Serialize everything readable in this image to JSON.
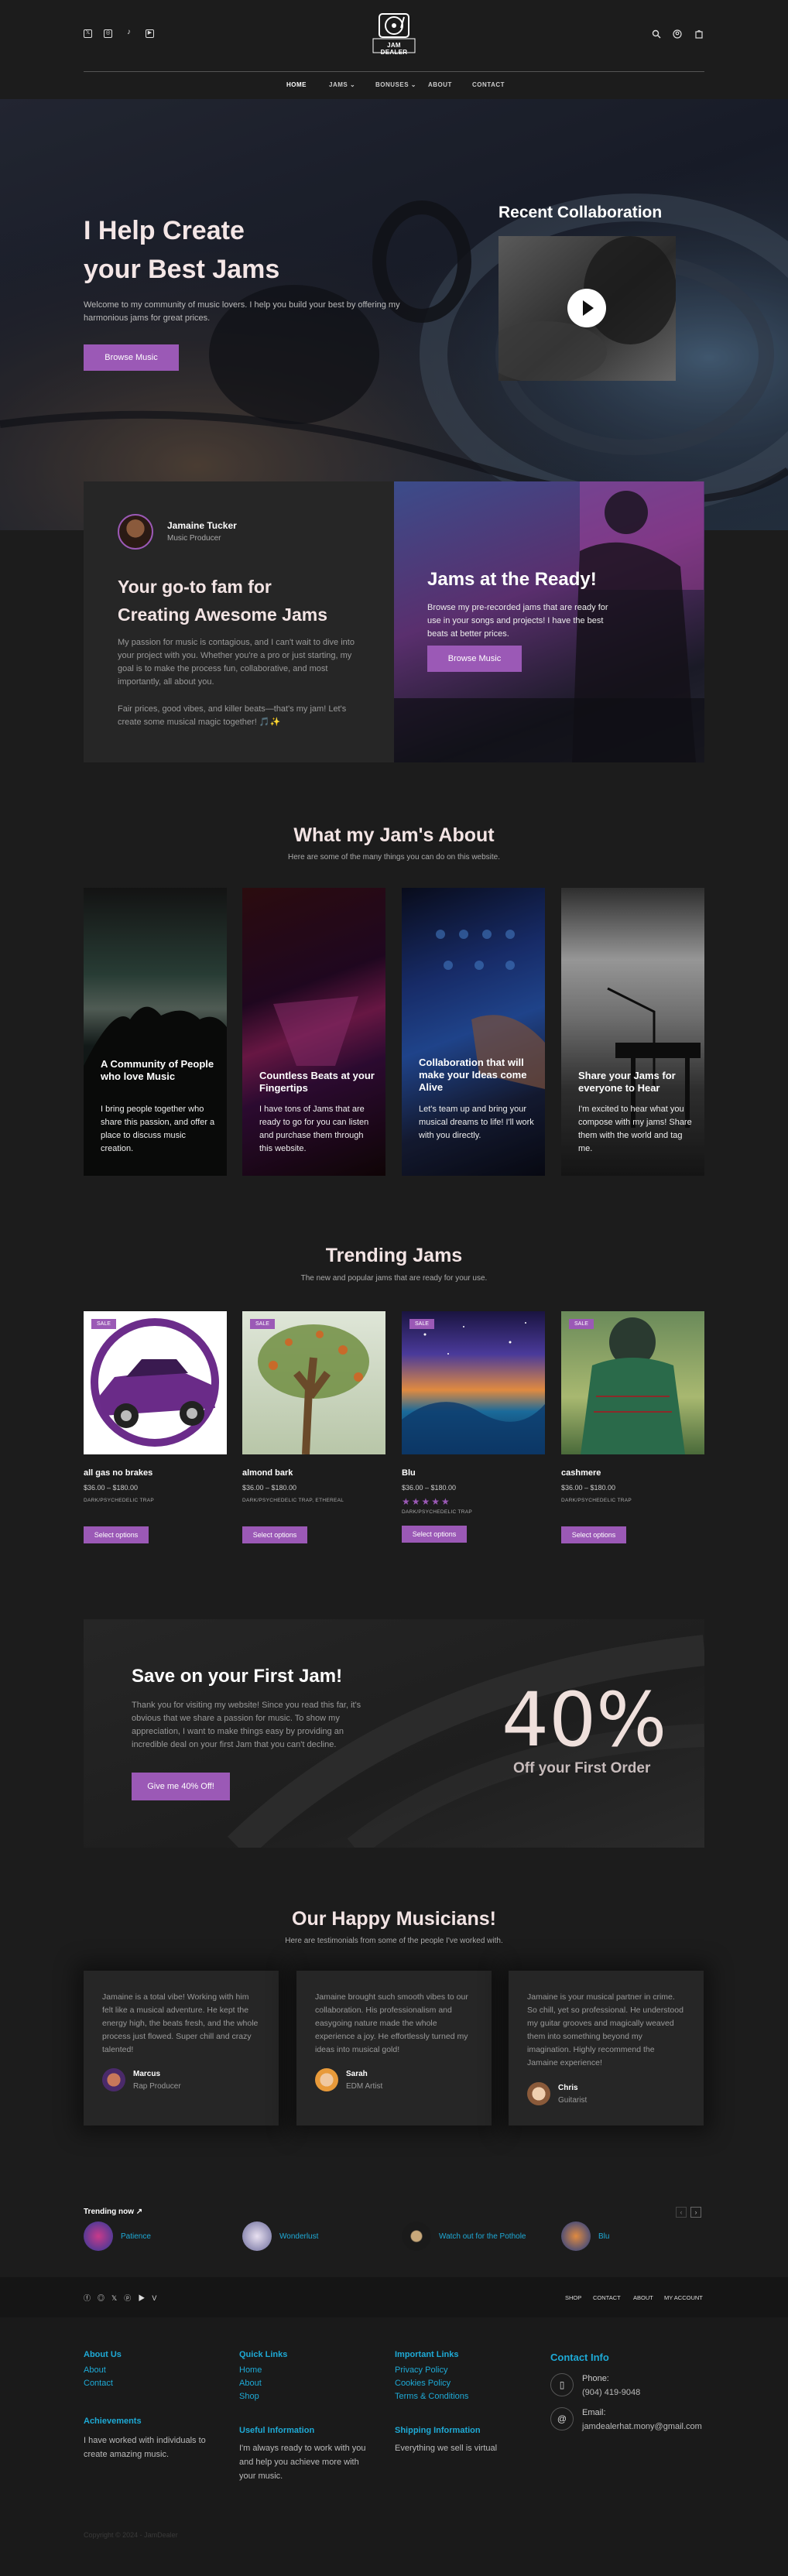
{
  "header": {
    "logo_line1": "JAM DEALER",
    "social_icons": [
      "x-icon",
      "instagram-icon",
      "tiktok-icon",
      "youtube-icon"
    ],
    "nav": [
      {
        "label": "HOME",
        "active": true
      },
      {
        "label": "JAMS",
        "dropdown": true
      },
      {
        "label": "BONUSES",
        "dropdown": true
      },
      {
        "label": "ABOUT"
      },
      {
        "label": "CONTACT"
      }
    ]
  },
  "hero": {
    "title_line1": "I Help Create",
    "title_line2": "your Best Jams",
    "text": "Welcome to my community of music lovers. I help you build your best by offering my harmonious jams for great prices.",
    "button": "Browse Music",
    "collab_title": "Recent Collaboration"
  },
  "about": {
    "name": "Jamaine Tucker",
    "role": "Music Producer",
    "title_line1": "Your go-to fam for",
    "title_line2": "Creating Awesome Jams",
    "para1": "My passion for music is contagious, and I can't wait to dive into your project with you. Whether you're a pro or just starting, my goal is to make the process fun, collaborative, and most importantly, all about you.",
    "para2": "Fair prices, good vibes, and killer beats—that's my jam! Let's create some musical magic together! 🎵✨",
    "ready_title": "Jams at the Ready!",
    "ready_text": "Browse my pre-recorded jams that are ready for use in your songs and projects! I have the best beats at better prices.",
    "ready_button": "Browse Music"
  },
  "features": {
    "title": "What my Jam's About",
    "subtitle": "Here are some of the many things you can do on this website.",
    "cards": [
      {
        "title": "A Community of People who love Music",
        "text": "I bring people together who share this passion, and offer a place to discuss music creation."
      },
      {
        "title": "Countless Beats at your Fingertips",
        "text": "I have tons of Jams that are ready to go for you can listen and purchase them through this website."
      },
      {
        "title": "Collaboration that will make your Ideas come Alive",
        "text": "Let's team up and bring your musical dreams to life! I'll work with you directly."
      },
      {
        "title": "Share your Jams for everyone to Hear",
        "text": "I'm excited to hear what you compose with my jams! Share them with the world and tag me."
      }
    ]
  },
  "trending": {
    "title": "Trending Jams",
    "subtitle": "The new and popular jams that are ready for your use.",
    "sale_label": "SALE",
    "products": [
      {
        "name": "all gas no brakes",
        "price": "$36.00 – $180.00",
        "category": "DARK/PSYCHEDELIC TRAP",
        "button": "Select options"
      },
      {
        "name": "almond bark",
        "price": "$36.00 – $180.00",
        "category": "DARK/PSYCHEDELIC TRAP, ETHEREAL",
        "button": "Select options"
      },
      {
        "name": "Blu",
        "price": "$36.00 – $180.00",
        "category": "DARK/PSYCHEDELIC TRAP",
        "rating": 5,
        "button": "Select options"
      },
      {
        "name": "cashmere",
        "price": "$36.00 – $180.00",
        "category": "DARK/PSYCHEDELIC TRAP",
        "button": "Select options"
      }
    ]
  },
  "promo": {
    "title": "Save on your First Jam!",
    "text": "Thank you for visiting my website! Since you read this far, it's obvious that we share a passion for music. To show my appreciation, I want to make things easy by providing an incredible deal on your first Jam that you can't decline.",
    "button": "Give me 40% Off!",
    "big": "40%",
    "big_sub": "Off your First Order"
  },
  "testimonials": {
    "title": "Our Happy Musicians!",
    "subtitle": "Here are testimonials from some of the people I've worked with.",
    "items": [
      {
        "text": "Jamaine is a total vibe! Working with him felt like a musical adventure. He kept the energy high, the beats fresh, and the whole process just flowed. Super chill and crazy talented!",
        "name": "Marcus",
        "role": "Rap Producer"
      },
      {
        "text": "Jamaine brought such smooth vibes to our collaboration. His professionalism and easygoing nature made the whole experience a joy. He effortlessly turned my ideas into musical gold!",
        "name": "Sarah",
        "role": "EDM Artist"
      },
      {
        "text": "Jamaine is your musical partner in crime. So chill, yet so professional. He understood my guitar grooves and magically weaved them into something beyond my imagination. Highly recommend the Jamaine experience!",
        "name": "Chris",
        "role": "Guitarist"
      }
    ]
  },
  "trending_now": {
    "label": "Trending now",
    "items": [
      "Patience",
      "Wonderlust",
      "Watch out for the Pothole",
      "Blu"
    ]
  },
  "footer": {
    "social_icons": [
      "facebook-icon",
      "instagram-icon",
      "x-icon",
      "pinterest-icon",
      "youtube-icon",
      "vimeo-icon"
    ],
    "links": [
      "SHOP",
      "CONTACT",
      "ABOUT",
      "MY ACCOUNT"
    ],
    "about_us": {
      "title": "About Us",
      "links": [
        "About",
        "Contact"
      ]
    },
    "quick_links": {
      "title": "Quick Links",
      "links": [
        "Home",
        "About",
        "Shop"
      ]
    },
    "important_links": {
      "title": "Important Links",
      "links": [
        "Privacy Policy",
        "Cookies Policy",
        "Terms & Conditions"
      ]
    },
    "contact_info": {
      "title": "Contact Info",
      "phone_label": "Phone:",
      "phone": "(904) 419-9048",
      "email_label": "Email:",
      "email": "jamdealerhat.mony@gmail.com"
    },
    "achievements": {
      "title": "Achievements",
      "text": "I have worked with individuals to create amazing music."
    },
    "useful_info": {
      "title": "Useful Information",
      "text": "I'm always ready to work with you and help you achieve more with your music."
    },
    "shipping_info": {
      "title": "Shipping Information",
      "text": "Everything we sell is virtual"
    },
    "copyright": "Copyright © 2024 - JamDealer"
  }
}
